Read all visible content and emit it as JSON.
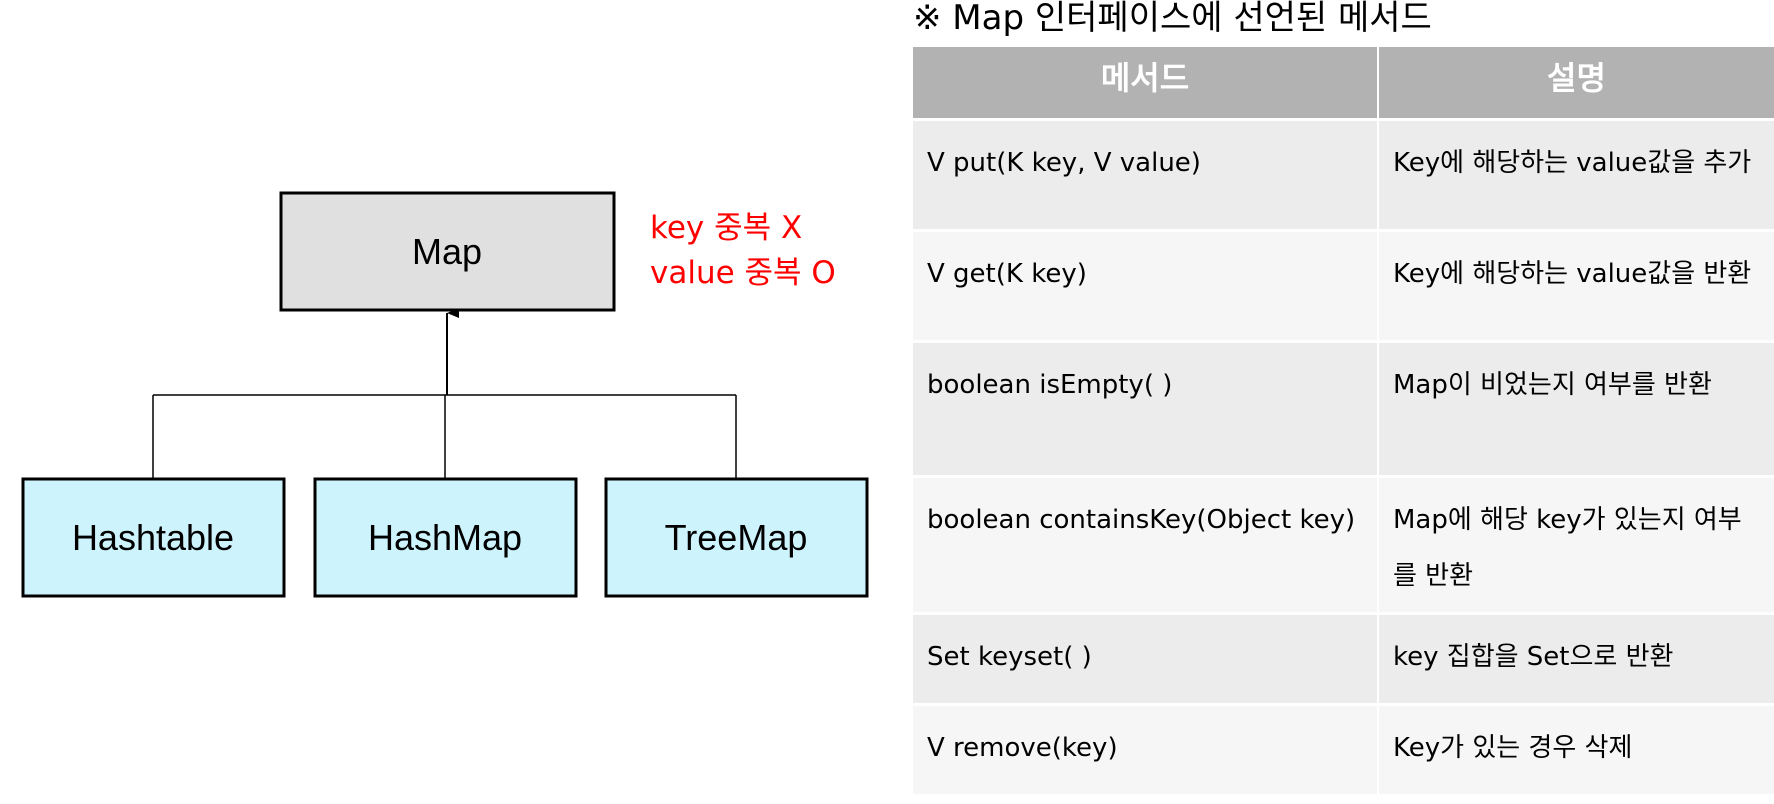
{
  "diagram": {
    "root": "Map",
    "children": [
      "Hashtable",
      "HashMap",
      "TreeMap"
    ],
    "note": [
      "key 중복 X",
      "value 중복 O"
    ],
    "colors": {
      "root_fill": "#e0e0e0",
      "child_fill": "#cdf3fd",
      "note": "#ff0000"
    }
  },
  "table": {
    "title": "※ Map 인터페이스에 선언된 메서드",
    "headers": [
      "메서드",
      "설명"
    ],
    "rows": [
      {
        "method": "V  put(K key, V value)",
        "desc": "Key에 해당하는 value값을 추가"
      },
      {
        "method": "V  get(K key)",
        "desc": "Key에 해당하는 value값을 반환"
      },
      {
        "method": "boolean  isEmpty( )",
        "desc": "Map이 비었는지 여부를 반환"
      },
      {
        "method": "boolean  containsKey(Object key)",
        "desc": "Map에 해당 key가 있는지 여부를 반환"
      },
      {
        "method": "Set  keyset( )",
        "desc": "key 집합을 Set으로 반환"
      },
      {
        "method": "V  remove(key)",
        "desc": "Key가 있는 경우 삭제"
      }
    ],
    "colors": {
      "header_bg": "#b2b2b2",
      "row_odd": "#ececec",
      "row_even": "#f6f6f6"
    }
  }
}
